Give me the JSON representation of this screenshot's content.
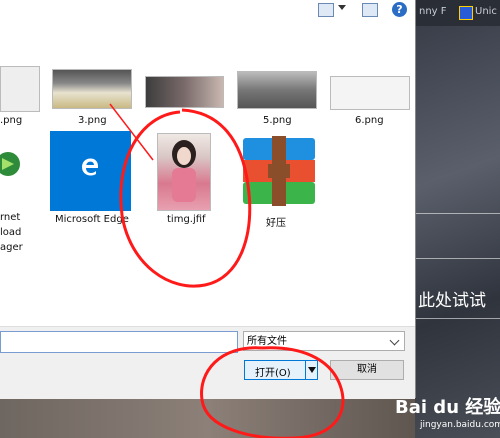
{
  "background": {
    "tabs": [
      {
        "label": "nny F"
      },
      {
        "label": "Unic"
      }
    ],
    "try_text": "此处试试"
  },
  "files": [
    {
      "name": ".png"
    },
    {
      "name": "3.png"
    },
    {
      "name": "5.png"
    },
    {
      "name": "6.png"
    },
    {
      "name_lines": [
        "rnet",
        "load",
        "ager"
      ]
    },
    {
      "name": "Microsoft Edge"
    },
    {
      "name": "timg.jfif"
    },
    {
      "name": "好压"
    }
  ],
  "filename_value": "",
  "file_type": {
    "selected": "所有文件"
  },
  "buttons": {
    "open": "打开(O)",
    "cancel": "取消"
  },
  "toolbar": {
    "help": "?"
  },
  "watermark": {
    "logo": "Bai du 经验",
    "url": "jingyan.baidu.com"
  },
  "colors": {
    "accent": "#0078d7",
    "annotation": "#ff1a1a"
  }
}
